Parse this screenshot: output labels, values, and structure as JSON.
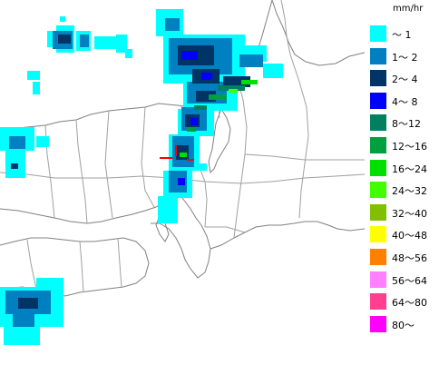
{
  "legend": {
    "unit": "mm/hr",
    "items": [
      {
        "label": "〜 1",
        "color": "#00ffff"
      },
      {
        "label": "1〜 2",
        "color": "#0080c0"
      },
      {
        "label": "2〜 4",
        "color": "#003366"
      },
      {
        "label": "4〜 8",
        "color": "#0000ff"
      },
      {
        "label": "8〜12",
        "color": "#008060"
      },
      {
        "label": "12〜16",
        "color": "#00a040"
      },
      {
        "label": "16〜24",
        "color": "#00e000"
      },
      {
        "label": "24〜32",
        "color": "#40ff00"
      },
      {
        "label": "32〜40",
        "color": "#80c000"
      },
      {
        "label": "40〜48",
        "color": "#ffff00"
      },
      {
        "label": "48〜56",
        "color": "#ff8000"
      },
      {
        "label": "56〜64",
        "color": "#ff80ff"
      },
      {
        "label": "64〜80",
        "color": "#ff4090"
      },
      {
        "label": "80〜",
        "color": "#ff00ff"
      }
    ]
  },
  "map_colors": {
    "land": "#ffffff",
    "sea": "#ffffff",
    "coast": "#808080",
    "border": "#a0a0a0"
  }
}
